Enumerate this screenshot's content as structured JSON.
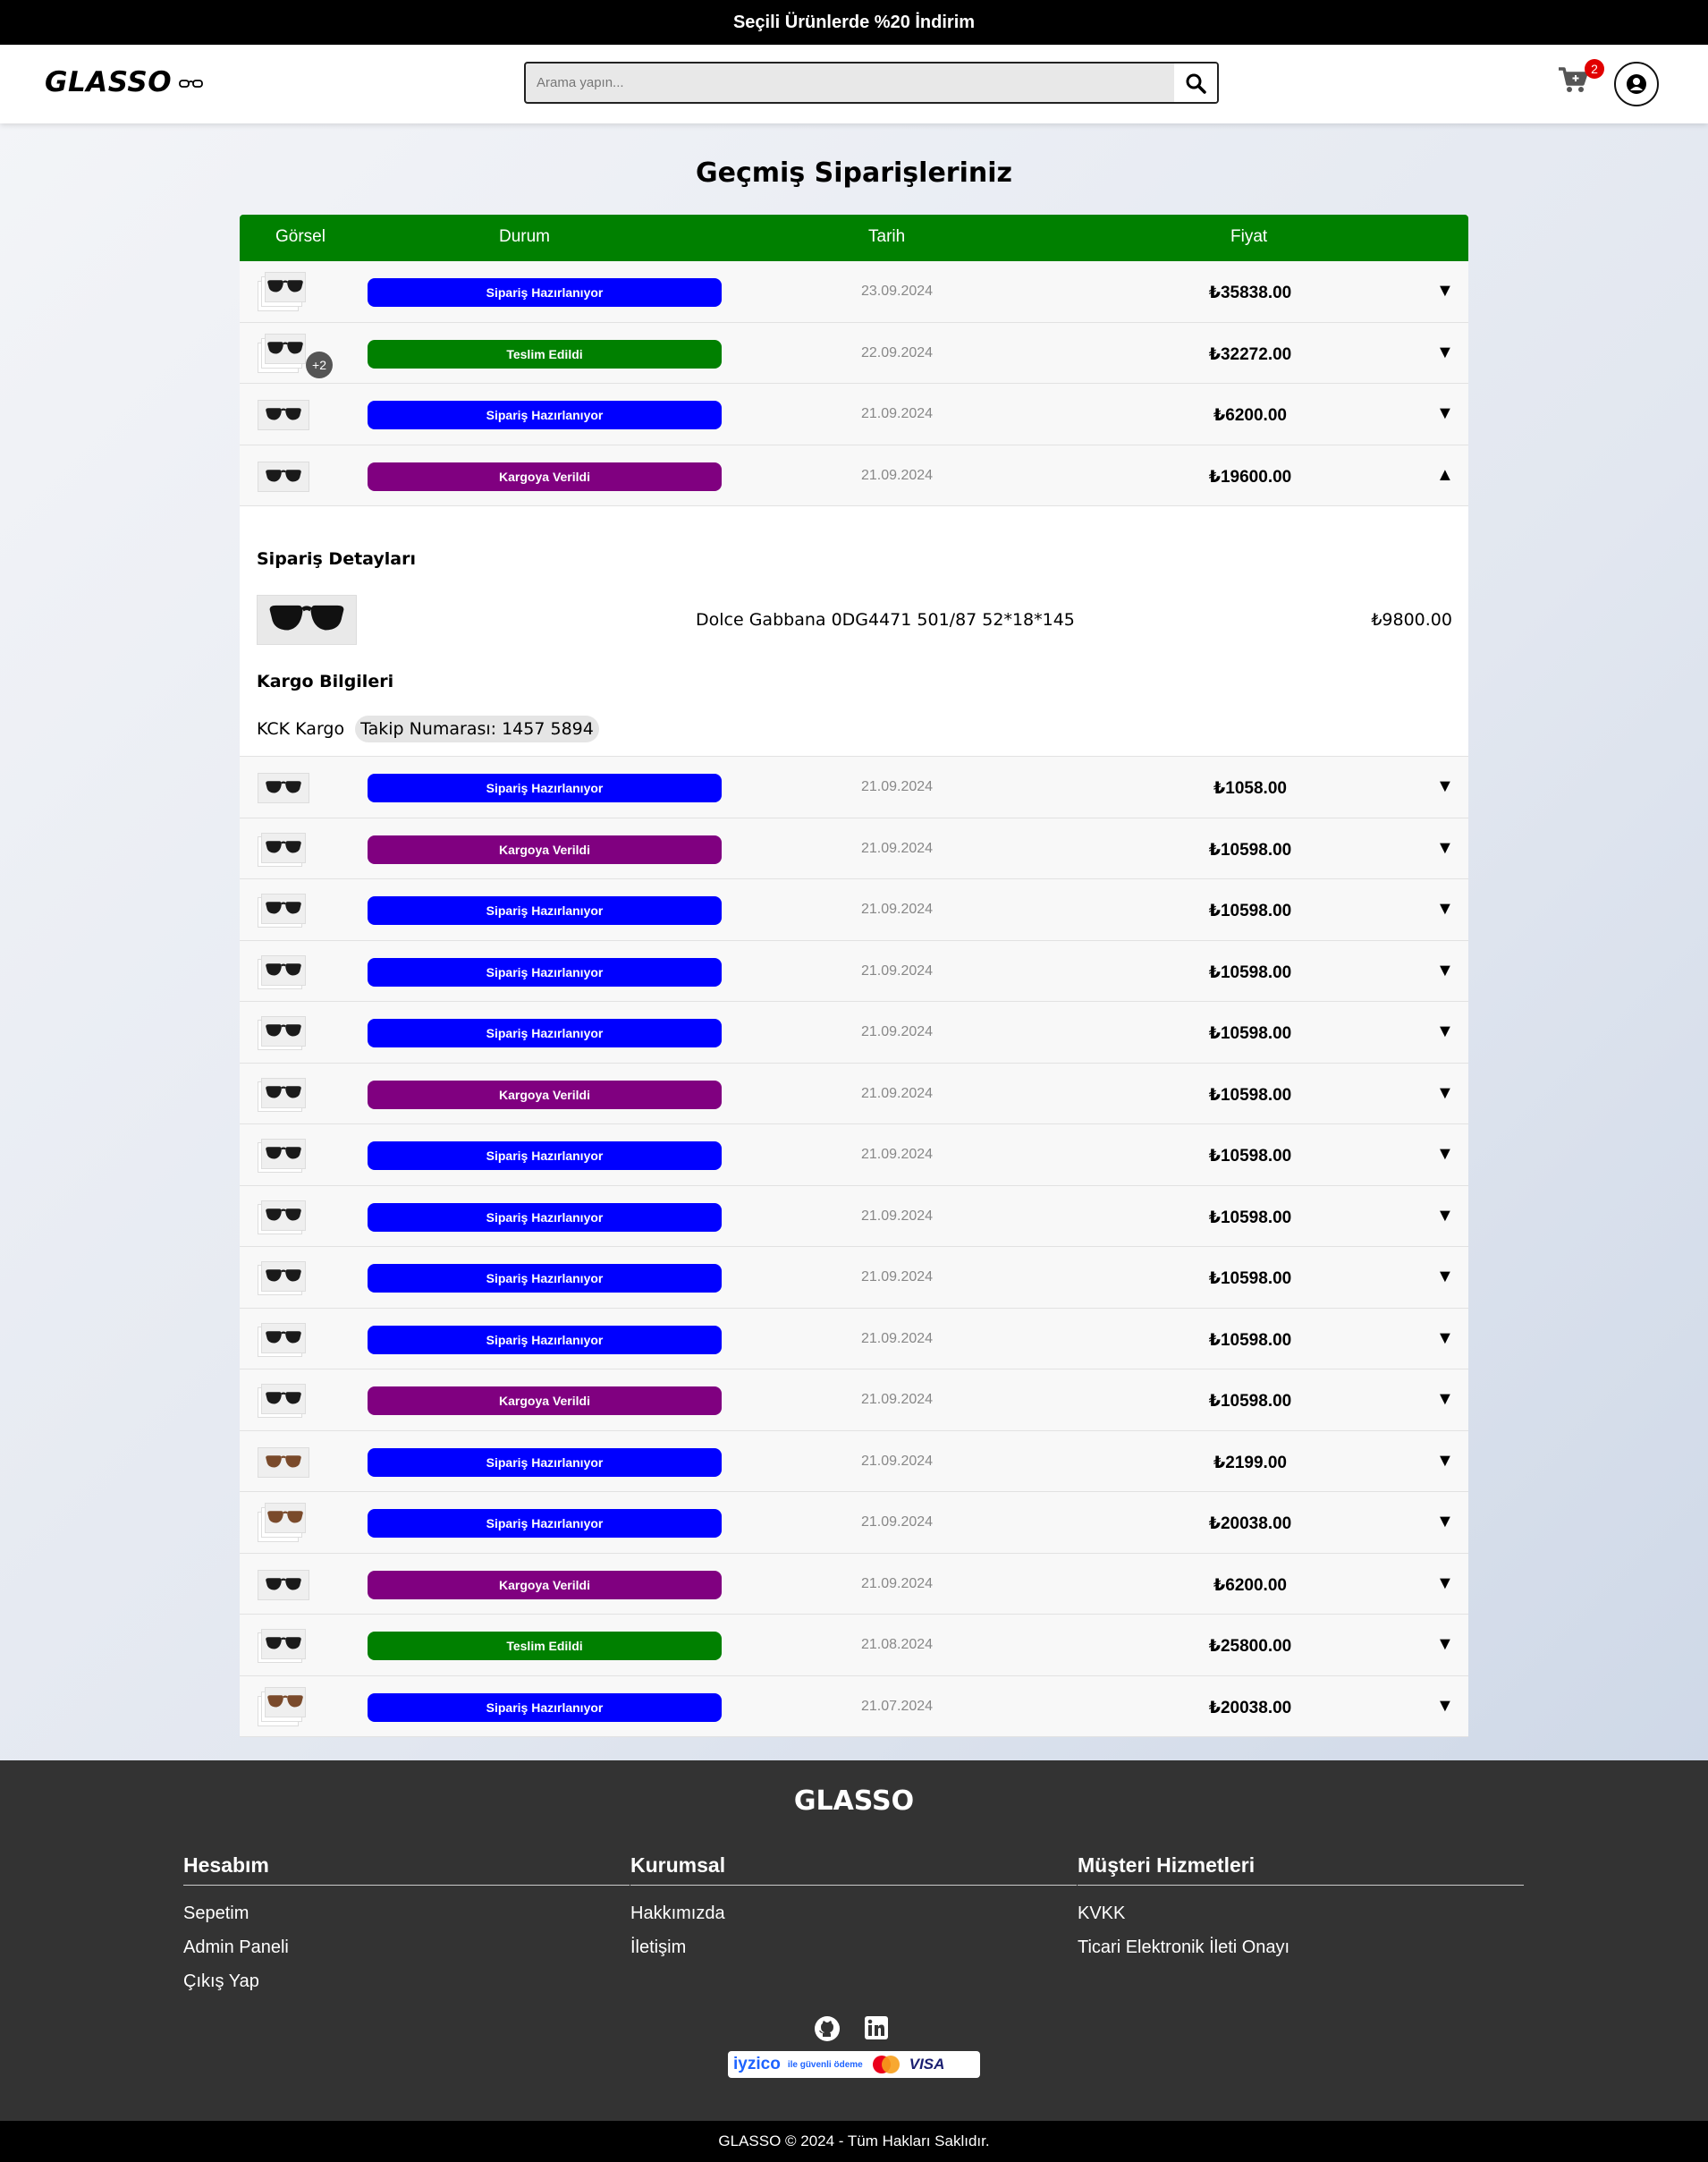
{
  "announcement": "Seçili Ürünlerde %20 İndirim",
  "header": {
    "logo": "GLASSO",
    "search_placeholder": "Arama yapın...",
    "cart_count": "2"
  },
  "page_title": "Geçmiş Siparişleriniz",
  "table": {
    "columns": [
      "Görsel",
      "Durum",
      "Tarih",
      "Fiyat"
    ]
  },
  "orders": [
    {
      "status": "Sipariş Hazırlanıyor",
      "date": "23.09.2024",
      "price": "₺35838.00",
      "toggle": "▼",
      "thumb": "stack"
    },
    {
      "status": "Teslim Edildi",
      "date": "22.09.2024",
      "price": "₺32272.00",
      "toggle": "▼",
      "thumb": "stack",
      "more": "+2"
    },
    {
      "status": "Sipariş Hazırlanıyor",
      "date": "21.09.2024",
      "price": "₺6200.00",
      "toggle": "▼",
      "thumb": "single"
    },
    {
      "status": "Kargoya Verildi",
      "date": "21.09.2024",
      "price": "₺19600.00",
      "toggle": "▲",
      "thumb": "single",
      "expanded": true
    },
    {
      "status": "Sipariş Hazırlanıyor",
      "date": "21.09.2024",
      "price": "₺1058.00",
      "toggle": "▼",
      "thumb": "single"
    },
    {
      "status": "Kargoya Verildi",
      "date": "21.09.2024",
      "price": "₺10598.00",
      "toggle": "▼",
      "thumb": "double"
    },
    {
      "status": "Sipariş Hazırlanıyor",
      "date": "21.09.2024",
      "price": "₺10598.00",
      "toggle": "▼",
      "thumb": "double"
    },
    {
      "status": "Sipariş Hazırlanıyor",
      "date": "21.09.2024",
      "price": "₺10598.00",
      "toggle": "▼",
      "thumb": "double"
    },
    {
      "status": "Sipariş Hazırlanıyor",
      "date": "21.09.2024",
      "price": "₺10598.00",
      "toggle": "▼",
      "thumb": "double"
    },
    {
      "status": "Kargoya Verildi",
      "date": "21.09.2024",
      "price": "₺10598.00",
      "toggle": "▼",
      "thumb": "double"
    },
    {
      "status": "Sipariş Hazırlanıyor",
      "date": "21.09.2024",
      "price": "₺10598.00",
      "toggle": "▼",
      "thumb": "double"
    },
    {
      "status": "Sipariş Hazırlanıyor",
      "date": "21.09.2024",
      "price": "₺10598.00",
      "toggle": "▼",
      "thumb": "double"
    },
    {
      "status": "Sipariş Hazırlanıyor",
      "date": "21.09.2024",
      "price": "₺10598.00",
      "toggle": "▼",
      "thumb": "double"
    },
    {
      "status": "Sipariş Hazırlanıyor",
      "date": "21.09.2024",
      "price": "₺10598.00",
      "toggle": "▼",
      "thumb": "double"
    },
    {
      "status": "Kargoya Verildi",
      "date": "21.09.2024",
      "price": "₺10598.00",
      "toggle": "▼",
      "thumb": "double"
    },
    {
      "status": "Sipariş Hazırlanıyor",
      "date": "21.09.2024",
      "price": "₺2199.00",
      "toggle": "▼",
      "thumb": "single-brown"
    },
    {
      "status": "Sipariş Hazırlanıyor",
      "date": "21.09.2024",
      "price": "₺20038.00",
      "toggle": "▼",
      "thumb": "stack-brown"
    },
    {
      "status": "Kargoya Verildi",
      "date": "21.09.2024",
      "price": "₺6200.00",
      "toggle": "▼",
      "thumb": "single"
    },
    {
      "status": "Teslim Edildi",
      "date": "21.08.2024",
      "price": "₺25800.00",
      "toggle": "▼",
      "thumb": "double"
    },
    {
      "status": "Sipariş Hazırlanıyor",
      "date": "21.07.2024",
      "price": "₺20038.00",
      "toggle": "▼",
      "thumb": "stack-brown"
    }
  ],
  "status_colors": {
    "Sipariş Hazırlanıyor": "#0000ff",
    "Teslim Edildi": "#008000",
    "Kargoya Verildi": "#800080"
  },
  "detail": {
    "heading": "Sipariş Detayları",
    "product_name": "Dolce Gabbana 0DG4471 501/87 52*18*145",
    "product_price": "₺9800.00",
    "cargo_heading": "Kargo Bilgileri",
    "cargo_company": "KCK Kargo",
    "tracking": "Takip Numarası: 1457 5894"
  },
  "footer": {
    "title": "GLASSO",
    "columns": [
      {
        "title": "Hesabım",
        "links": [
          "Sepetim",
          "Admin Paneli",
          "Çıkış Yap"
        ]
      },
      {
        "title": "Kurumsal",
        "links": [
          "Hakkımızda",
          "İletişim"
        ]
      },
      {
        "title": "Müşteri Hizmetleri",
        "links": [
          "KVKK",
          "Ticari Elektronik İleti Onayı"
        ]
      }
    ],
    "social_icons": [
      "github-icon",
      "linkedin-icon"
    ],
    "payment_brand": "iyzico",
    "payment_text": "ile güvenli ödeme",
    "payment_visa": "VISA",
    "copyright": "GLASSO © 2024 - Tüm Hakları Saklıdır."
  }
}
